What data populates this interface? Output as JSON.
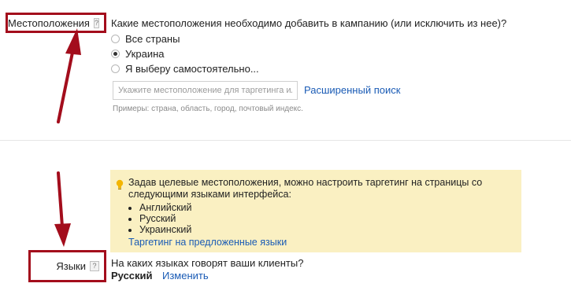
{
  "locations": {
    "label": "Местоположения",
    "help": "?",
    "question": "Какие местоположения необходимо добавить в кампанию (или исключить из нее)?",
    "options": [
      {
        "label": "Все страны",
        "selected": false
      },
      {
        "label": "Украина",
        "selected": true
      },
      {
        "label": "Я выберу самостоятельно...",
        "selected": false
      }
    ],
    "search_placeholder": "Укажите местоположение для таргетинга или",
    "advanced_search": "Расширенный поиск",
    "examples_hint": "Примеры: страна, область, город, почтовый индекс."
  },
  "notice": {
    "text": "Задав целевые местоположения, можно настроить таргетинг на страницы со следующими языками интерфейса:",
    "languages": [
      "Английский",
      "Русский",
      "Украинский"
    ],
    "link": "Таргетинг на предложенные языки",
    "background": "#faf0c2"
  },
  "languages": {
    "label": "Языки",
    "help": "?",
    "question": "На каких языках говорят ваши клиенты?",
    "value": "Русский",
    "change_link": "Изменить"
  },
  "colors": {
    "annotation_red": "#a30d1c",
    "link_blue": "#1a5bb5"
  }
}
